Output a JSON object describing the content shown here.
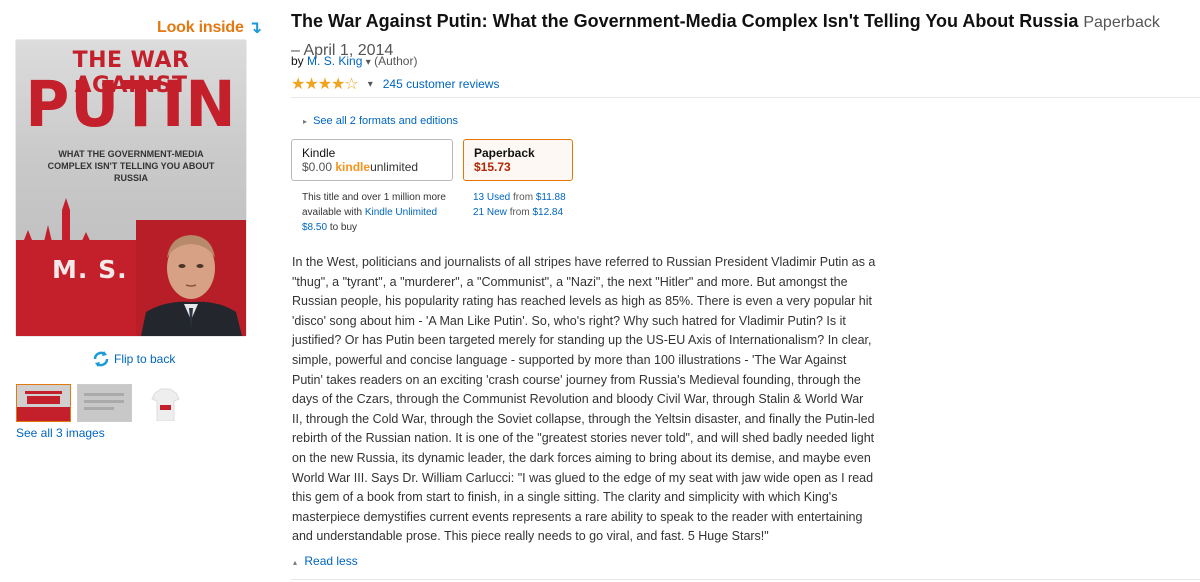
{
  "look_inside": {
    "label": "Look inside"
  },
  "cover": {
    "title_line1": "THE WAR AGAINST",
    "title_line2": "PUTIN",
    "subtitle": "WHAT THE GOVERNMENT-MEDIA COMPLEX ISN'T TELLING YOU ABOUT RUSSIA",
    "author": "M. S. KING"
  },
  "flip": {
    "label": "Flip to back"
  },
  "see_all_images": {
    "label": "See all 3 images"
  },
  "product": {
    "title": "The War Against Putin: What the Government-Media Complex Isn't Telling You About Russia",
    "format": "Paperback",
    "date": "– April 1, 2014",
    "by": "by",
    "author": "M. S. King",
    "role": "(Author)",
    "rating_stars": "★★★★☆",
    "reviews": "245 customer reviews"
  },
  "formats": {
    "see_all": "See all 2 formats and editions",
    "kindle": {
      "name": "Kindle",
      "price": "$0.00",
      "ku_kindle": "kindle",
      "ku_unlimited": "unlimited",
      "note_1": "This title and over 1 million more available with",
      "note_link": "Kindle Unlimited",
      "note_price": "$8.50",
      "note_2": "to buy"
    },
    "paperback": {
      "name": "Paperback",
      "price": "$15.73",
      "used_link": "13 Used",
      "used_from": "from",
      "used_price": "$11.88",
      "new_link": "21 New",
      "new_from": "from",
      "new_price": "$12.84"
    }
  },
  "description": {
    "text": "In the West, politicians and journalists of all stripes have referred to Russian President Vladimir Putin as a \"thug\", a \"tyrant\", a \"murderer\", a \"Communist\", a \"Nazi\", the next \"Hitler\" and more. But amongst the Russian people, his popularity rating has reached levels as high as 85%. There is even a very popular hit 'disco' song about him - 'A Man Like Putin'. So, who's right? Why such hatred for Vladimir Putin? Is it justified? Or has Putin been targeted merely for standing up the US-EU Axis of Internationalism? In clear, simple, powerful and concise language - supported by more than 100 illustrations - 'The War Against Putin' takes readers on an exciting 'crash course' journey from Russia's Medieval founding, through the days of the Czars, through the Communist Revolution and bloody Civil War, through Stalin & World War II, through the Cold War, through the Soviet collapse, through the Yeltsin disaster, and finally the Putin-led rebirth of the Russian nation. It is one of the \"greatest stories never told\", and will shed badly needed light on the new Russia, its dynamic leader, the dark forces aiming to bring about its demise, and maybe even World War III. Says Dr. William Carlucci: \"I was glued to the edge of my seat with jaw wide open as I read this gem of a book from start to finish, in a single sitting. The clarity and simplicity with which King's masterpiece demystifies current events represents a rare ability to speak to the reader with entertaining and understandable prose. This piece really needs to go viral, and fast. 5 Huge Stars!\"",
    "read_less": "Read less"
  },
  "colors": {
    "link": "#0066c0",
    "look_inside": "#e47911",
    "price": "#b12704",
    "star": "#f0a41d",
    "cover_red": "#c3202b"
  }
}
